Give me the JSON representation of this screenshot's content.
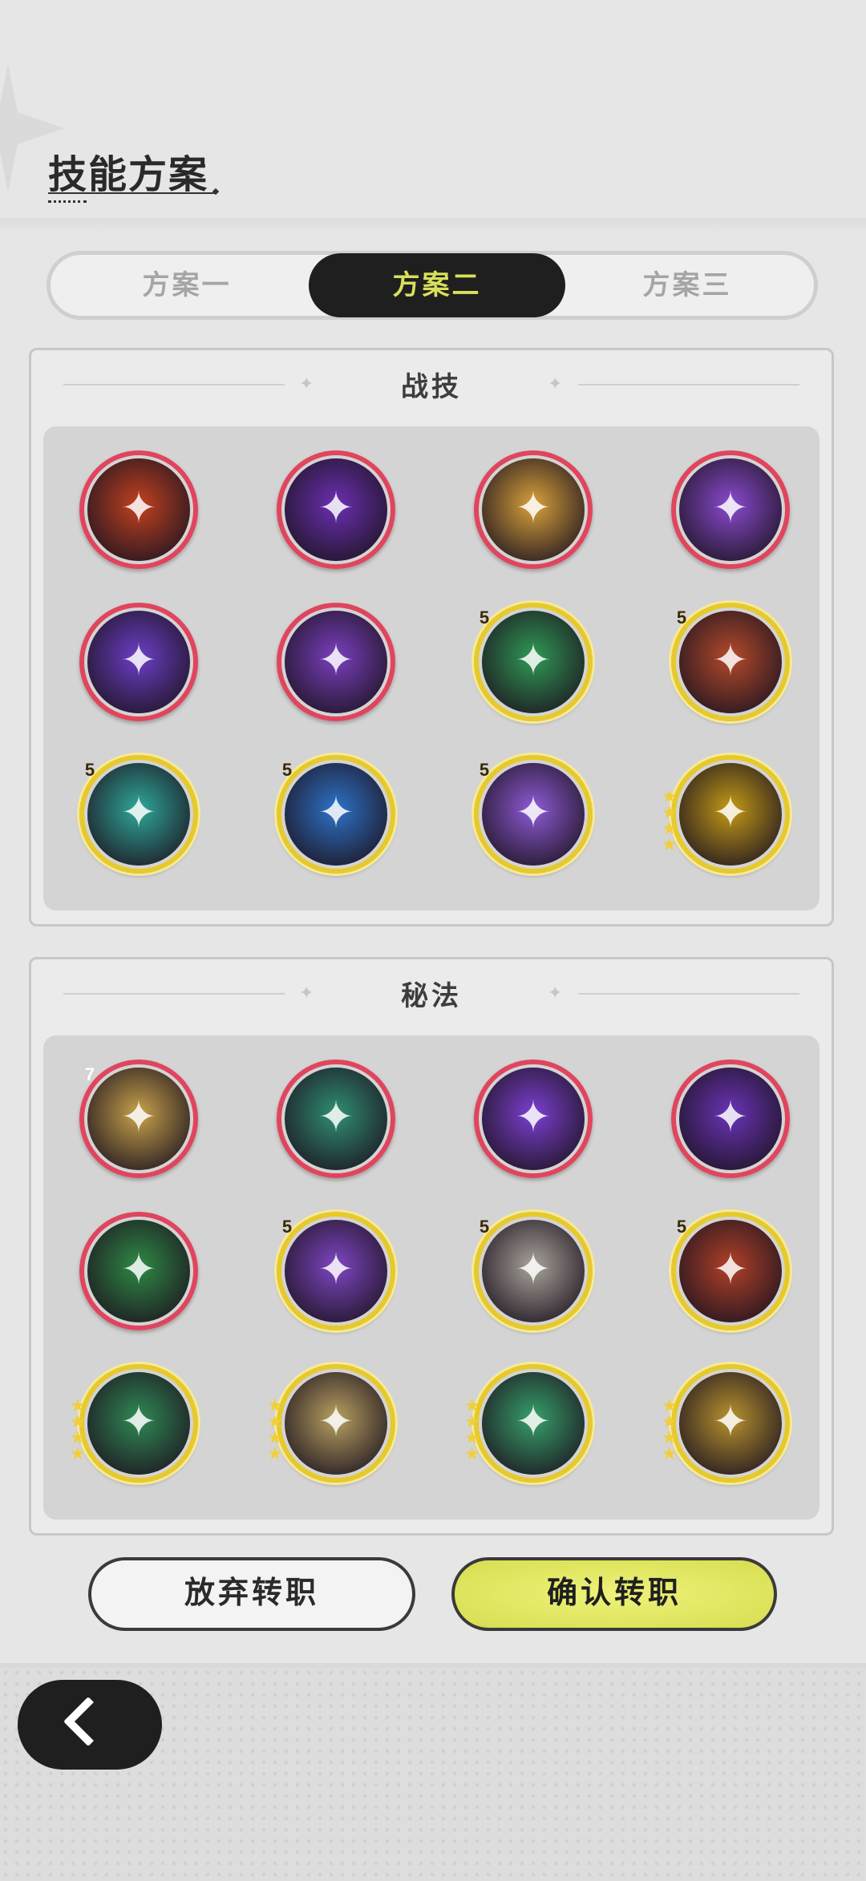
{
  "header": {
    "title": "技能方案"
  },
  "tabs": [
    {
      "label": "方案一",
      "selected": false
    },
    {
      "label": "方案二",
      "selected": true
    },
    {
      "label": "方案三",
      "selected": false
    }
  ],
  "sections": {
    "combat": {
      "title": "战技",
      "skills": [
        {
          "icon": "fire-swirl-icon",
          "rarity": "red",
          "color": "#c2411f",
          "badge": ""
        },
        {
          "icon": "violet-star-burst-icon",
          "rarity": "red",
          "color": "#6b2fb3",
          "badge": ""
        },
        {
          "icon": "golem-icon",
          "rarity": "red",
          "color": "#d9a13a",
          "badge": ""
        },
        {
          "icon": "purple-guardian-icon",
          "rarity": "red",
          "color": "#8a4ad0",
          "badge": ""
        },
        {
          "icon": "void-vortex-icon",
          "rarity": "red",
          "color": "#6c3ec8",
          "badge": ""
        },
        {
          "icon": "violet-shield-icon",
          "rarity": "red",
          "color": "#7a3fc0",
          "badge": ""
        },
        {
          "icon": "green-flame-icon",
          "rarity": "gold",
          "color": "#2f9a55",
          "badge": "5"
        },
        {
          "icon": "ember-totem-icon",
          "rarity": "gold",
          "color": "#b54a2a",
          "badge": "5"
        },
        {
          "icon": "teal-whirlpool-icon",
          "rarity": "gold",
          "color": "#2ea89a",
          "badge": "5"
        },
        {
          "icon": "ice-crystal-icon",
          "rarity": "gold",
          "color": "#2d73c9",
          "badge": "5"
        },
        {
          "icon": "purple-sigil-icon",
          "rarity": "gold",
          "color": "#8e5ad6",
          "badge": "5"
        },
        {
          "icon": "gold-crystal-icon",
          "rarity": "gold",
          "color": "#c49a16",
          "badge": "",
          "stars": 4
        }
      ]
    },
    "arcane": {
      "title": "秘法",
      "skills": [
        {
          "icon": "golden-prayer-icon",
          "rarity": "red",
          "color": "#c8a24a",
          "badge": "7",
          "badge_color": "red"
        },
        {
          "icon": "green-spirit-icon",
          "rarity": "red",
          "color": "#2f8f74",
          "badge": ""
        },
        {
          "icon": "purple-orb-icon",
          "rarity": "red",
          "color": "#7b3fd1",
          "badge": ""
        },
        {
          "icon": "purple-fist-icon",
          "rarity": "red",
          "color": "#6a33b8",
          "badge": ""
        },
        {
          "icon": "green-rune-icon",
          "rarity": "red",
          "color": "#2e8a45",
          "badge": ""
        },
        {
          "icon": "violet-ghost-icon",
          "rarity": "gold",
          "color": "#7e46c4",
          "badge": "5"
        },
        {
          "icon": "grey-figure-icon",
          "rarity": "gold",
          "color": "#a9a39a",
          "badge": "5"
        },
        {
          "icon": "red-shatter-icon",
          "rarity": "gold",
          "color": "#b24028",
          "badge": "5"
        },
        {
          "icon": "green-wings-icon",
          "rarity": "gold",
          "color": "#2f8a55",
          "badge": "",
          "stars": 4
        },
        {
          "icon": "gold-arrows-icon",
          "rarity": "gold",
          "color": "#b8a060",
          "badge": "",
          "stars": 4
        },
        {
          "icon": "green-heart-icon",
          "rarity": "gold",
          "color": "#36a06a",
          "badge": "",
          "stars": 4
        },
        {
          "icon": "gold-claw-icon",
          "rarity": "gold",
          "color": "#b8922e",
          "badge": "",
          "stars": 4
        }
      ]
    }
  },
  "actions": {
    "abandon_label": "放弃转职",
    "confirm_label": "确认转职"
  },
  "nav": {
    "back_icon": "chevron-left-icon"
  }
}
